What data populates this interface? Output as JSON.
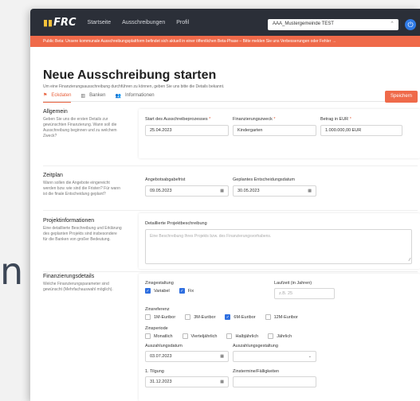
{
  "side_letter": "n",
  "app": {
    "logo_text": "FRC",
    "nav": [
      "Startseite",
      "Ausschreibungen",
      "Profil"
    ],
    "tenant": "AAA_Mustergemeinde TEST",
    "tenant_chevron": "⌃",
    "power_glyph": "⏻"
  },
  "banner": "Public Beta: Unsere kommunale Ausschreibungsplattform befindet sich aktuell in einer öffentlichen Beta-Phase – Bitte melden Sie uns Verbesserungen oder Fehler →",
  "page": {
    "title": "Neue Ausschreibung starten",
    "subtitle": "Um eine Finanzierungsausschreibung durchführen zu können, geben Sie uns bitte die Details bekannt.",
    "tabs": [
      {
        "label": "Eckdaten",
        "icon": "flag-icon",
        "active": true
      },
      {
        "label": "Banken",
        "icon": "bank-icon",
        "active": false
      },
      {
        "label": "Informationen",
        "icon": "users-icon",
        "active": false
      }
    ],
    "save_label": "Speichern"
  },
  "allgemein": {
    "title": "Allgemein",
    "desc": "Geben Sie uns die ersten Details zur gewünschten Finanzierung. Wann soll die Ausschreibung beginnen und zu welchem Zweck?",
    "start_label": "Start des Ausschreibeprozesses",
    "start_value": "25.04.2023",
    "zweck_label": "Finanzierungszweck",
    "zweck_value": "Kindergarten",
    "betrag_label": "Betrag in EUR",
    "betrag_value": "1.000.000,00 EUR",
    "required_mark": "*"
  },
  "zeitplan": {
    "title": "Zeitplan",
    "desc": "Wann sollen die Angebote eingereicht werden bzw. wie sind die Fristen? Für wann ist die finale Entscheidung geplant?",
    "frist_label": "Angebotsabgabefrist",
    "frist_value": "09.05.2023",
    "entscheidung_label": "Geplantes Entscheidungsdatum",
    "entscheidung_value": "30.05.2023"
  },
  "projekt": {
    "title": "Projektinformationen",
    "desc": "Eine detaillierte Beschreibung und Erklärung des geplanten Projekts sind insbesondere für die Banken von großer Bedeutung.",
    "beschreibung_label": "Detaillierte Projektbeschreibung",
    "beschreibung_placeholder": "Eine Beschreibung Ihres Projekts bzw. des Finanzierungsvorhabens."
  },
  "finanzierung": {
    "title": "Finanzierungsdetails",
    "desc": "Welche Finanzierungsparameter sind gewünscht (Mehrfachauswahl möglich).",
    "zins_label": "Zinsgestaltung",
    "zins_options": [
      {
        "label": "Variabel",
        "checked": true
      },
      {
        "label": "Fix",
        "checked": true
      }
    ],
    "laufzeit_label": "Laufzeit (in Jahren)",
    "laufzeit_placeholder": "z.B. 25",
    "referenz_label": "Zinsreferenz",
    "referenz_options": [
      {
        "label": "1M-Euribor",
        "checked": false
      },
      {
        "label": "3M-Euribor",
        "checked": false
      },
      {
        "label": "6M-Euribor",
        "checked": true
      },
      {
        "label": "12M-Euribor",
        "checked": false
      }
    ],
    "periode_label": "Zinsperiode",
    "periode_options": [
      {
        "label": "Monatlich",
        "checked": false
      },
      {
        "label": "Vierteljährlich",
        "checked": false
      },
      {
        "label": "Halbjährlich",
        "checked": false
      },
      {
        "label": "Jährlich",
        "checked": false
      }
    ],
    "auszahlung_label": "Auszahlungsdatum",
    "auszahlung_value": "03.07.2023",
    "gestaltung_label": "Auszahlungsgestaltung",
    "tilgung_label": "1. Tilgung",
    "tilgung_value": "31.12.2023",
    "zinstermine_label": "Zinstermine/Fälligkeiten"
  },
  "icons": {
    "calendar": "▦",
    "chevron": "⌄",
    "check": "✓",
    "resize": "⁄⁄"
  }
}
